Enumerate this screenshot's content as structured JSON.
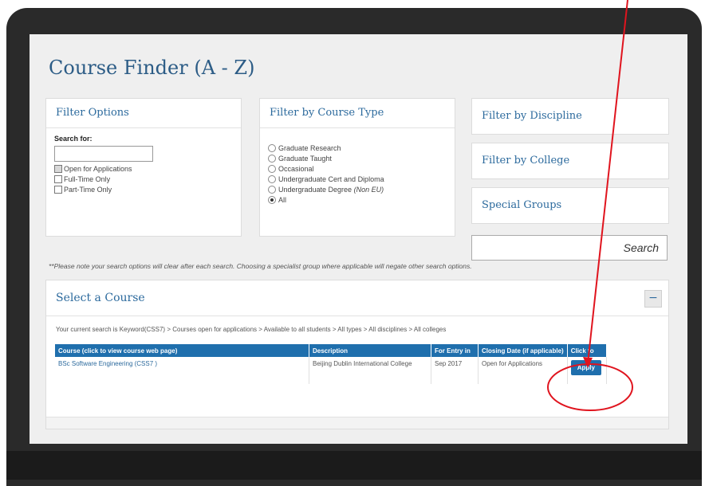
{
  "page": {
    "title": "Course Finder (A - Z)"
  },
  "filter_options": {
    "heading": "Filter Options",
    "search_label": "Search for:",
    "search_value": "",
    "options": [
      {
        "label": "Open for Applications",
        "checked": true
      },
      {
        "label": "Full-Time Only",
        "checked": false
      },
      {
        "label": "Part-Time Only",
        "checked": false
      }
    ]
  },
  "course_type": {
    "heading": "Filter by Course Type",
    "options": [
      {
        "label": "Graduate Research",
        "selected": false
      },
      {
        "label": "Graduate Taught",
        "selected": false
      },
      {
        "label": "Occasional",
        "selected": false
      },
      {
        "label": "Undergraduate Cert and Diploma",
        "selected": false
      },
      {
        "label": "Undergraduate Degree",
        "suffix": "(Non EU)",
        "selected": false
      },
      {
        "label": "All",
        "selected": true
      }
    ]
  },
  "right_filters": {
    "discipline": "Filter by Discipline",
    "college": "Filter by College",
    "special": "Special Groups",
    "search_button": "Search"
  },
  "note": "**Please note your search options will clear after each search. Choosing a specialist group where applicable will negate other search options.",
  "results": {
    "heading": "Select a Course",
    "collapse_symbol": "−",
    "breadcrumb": "Your current search is Keyword(CSS7) > Courses open for applications > Available to all students > All types > All disciplines > All colleges",
    "columns": [
      "Course (click to view course web page)",
      "Description",
      "For Entry in",
      "Closing Date (if applicable)",
      "Click to"
    ],
    "rows": [
      {
        "course": "BSc Software Engineering (CSS7 )",
        "description": "Beijing Dublin International College",
        "entry": "Sep 2017",
        "closing": "Open for Applications",
        "action": "Apply"
      }
    ]
  },
  "colors": {
    "accent": "#1f6fad",
    "heading": "#2c6a9d",
    "annotation": "#e0141e"
  }
}
